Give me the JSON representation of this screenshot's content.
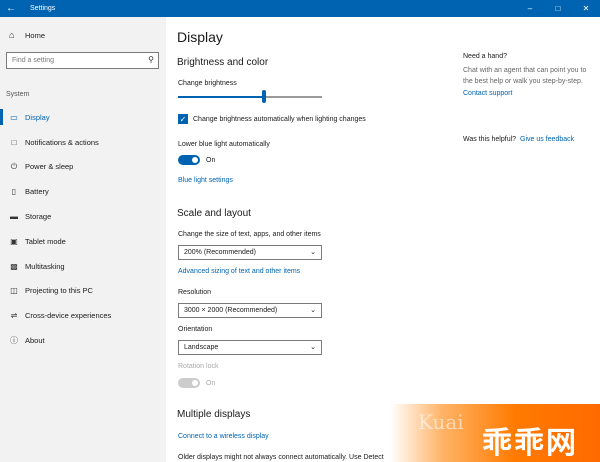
{
  "window": {
    "title": "Settings"
  },
  "nav": {
    "home": "Home",
    "search_placeholder": "Find a setting",
    "section": "System",
    "items": [
      {
        "label": "Display",
        "icon": "monitor-icon"
      },
      {
        "label": "Notifications & actions",
        "icon": "notifications-icon"
      },
      {
        "label": "Power & sleep",
        "icon": "power-icon"
      },
      {
        "label": "Battery",
        "icon": "battery-icon"
      },
      {
        "label": "Storage",
        "icon": "storage-icon"
      },
      {
        "label": "Tablet mode",
        "icon": "tablet-icon"
      },
      {
        "label": "Multitasking",
        "icon": "multitasking-icon"
      },
      {
        "label": "Projecting to this PC",
        "icon": "projecting-icon"
      },
      {
        "label": "Cross-device experiences",
        "icon": "cross-device-icon"
      },
      {
        "label": "About",
        "icon": "info-icon"
      }
    ]
  },
  "main": {
    "title": "Display",
    "brightness": {
      "heading": "Brightness and color",
      "change_label": "Change brightness",
      "level": 0.6,
      "auto_checkbox": "Change brightness automatically when lighting changes",
      "blue_light_label": "Lower blue light automatically",
      "blue_light_state": "On",
      "blue_light_link": "Blue light settings"
    },
    "scale": {
      "heading": "Scale and layout",
      "size_label": "Change the size of text, apps, and other items",
      "size_value": "200% (Recommended)",
      "advanced_link": "Advanced sizing of text and other items",
      "resolution_label": "Resolution",
      "resolution_value": "3000 × 2000 (Recommended)",
      "orientation_label": "Orientation",
      "orientation_value": "Landscape",
      "rotation_label": "Rotation lock",
      "rotation_state": "On"
    },
    "multiple": {
      "heading": "Multiple displays",
      "wireless_link": "Connect to a wireless display",
      "older_text": "Older displays might not always connect automatically. Use Detect"
    }
  },
  "help": {
    "title": "Need a hand?",
    "desc": "Chat with an agent that can point you to the best help or walk you step-by-step.",
    "contact": "Contact support",
    "helpful": "Was this helpful?",
    "feedback": "Give us feedback"
  },
  "watermark": {
    "latin": "Kuai",
    "cn": "乖乖网"
  },
  "colors": {
    "accent": "#0063b1",
    "nav_bg": "#f2f2f2"
  }
}
